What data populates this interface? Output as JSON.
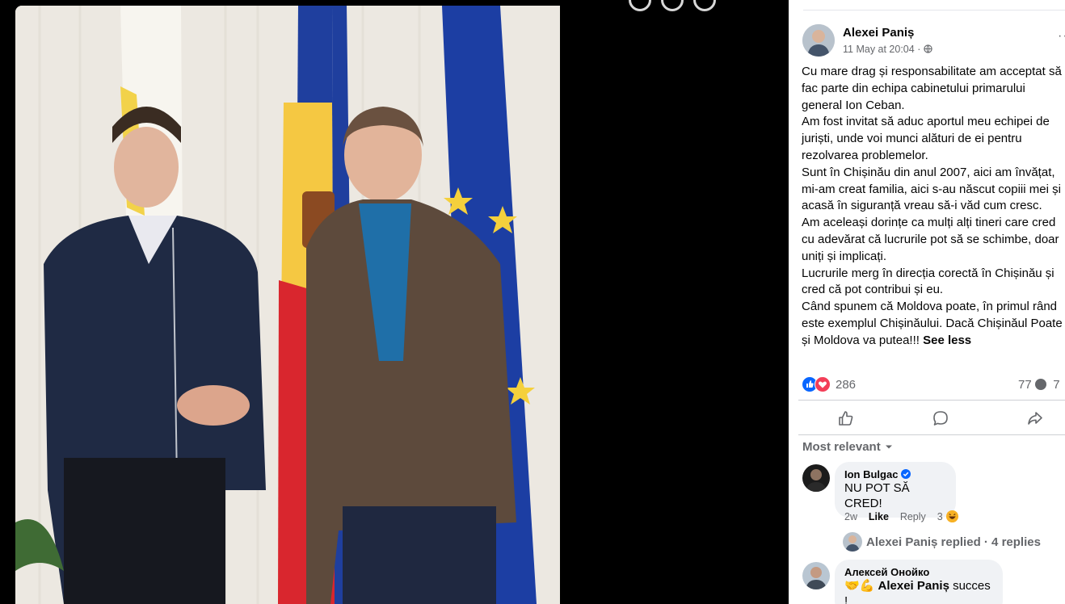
{
  "post": {
    "author": "Alexei Paniș",
    "date": "11 May at 20:04 · ",
    "privacy_icon": "globe-icon",
    "more_icon": "more-icon",
    "text_lines": [
      "Cu mare drag și responsabilitate am acceptat să",
      "fac parte din echipa cabinetului primarului",
      "general Ion Ceban.",
      "Am fost invitat să aduc aportul meu echipei de",
      "juriști, unde voi munci alături de ei pentru",
      "rezolvarea problemelor.",
      "Sunt în Chișinău din anul 2007, aici am învățat,",
      "mi-am creat familia, aici s-au născut copiii mei și",
      "acasă în siguranță vreau să-i văd cum cresc.",
      "Am aceleași dorințe ca mulți alți tineri care cred",
      "cu adevărat că lucrurile pot să se schimbe, doar",
      "uniți și implicați.",
      "Lucrurile merg în direcția corectă în Chișinău și",
      "cred că pot contribui și eu.",
      "Când spunem că Moldova poate, în primul rând",
      "este exemplul Chișinăului. Dacă Chișinăul Poate",
      "și Moldova va putea!!!"
    ],
    "see_less": "See less"
  },
  "reactions": {
    "count": "286",
    "comments": "77",
    "shares": "7",
    "icons": [
      "like-reaction-icon",
      "love-reaction-icon"
    ]
  },
  "actions": {
    "like_icon": "like-icon",
    "comment_icon": "comment-icon",
    "share_icon": "share-icon"
  },
  "filter": {
    "label": "Most relevant"
  },
  "comments": [
    {
      "name": "Ion Bulgac",
      "verified": true,
      "text": "NU POT SĂ CRED!",
      "time": "2w",
      "like": "Like",
      "reply": "Reply",
      "reaction_count": "3",
      "replied_text": "Alexei Paniș replied · 4 replies"
    },
    {
      "name": "Алексей Онойко",
      "mention": "Alexei Paniș",
      "text": " succes !"
    }
  ],
  "colors": {
    "facebook_blue": "#0866ff",
    "love_red": "#f33e58",
    "text_primary": "#050505",
    "text_secondary": "#65676b"
  }
}
